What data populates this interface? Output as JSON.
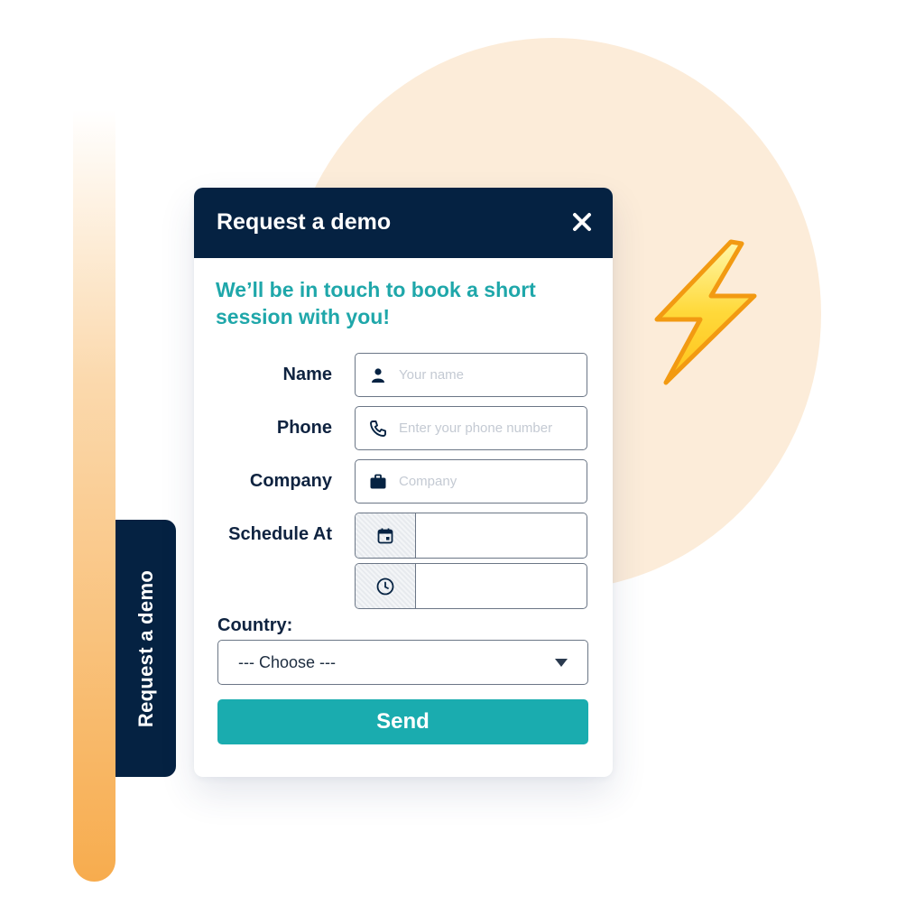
{
  "modal": {
    "title": "Request a demo",
    "close_icon": "close-icon",
    "intro": "We’ll be in touch to book a short session with you!"
  },
  "side_tab": {
    "label": "Request a demo"
  },
  "decoration": {
    "bolt_icon": "lightning-icon"
  },
  "form": {
    "name": {
      "label": "Name",
      "placeholder": "Your name",
      "value": "",
      "icon": "person-icon"
    },
    "phone": {
      "label": "Phone",
      "placeholder": "Enter your phone number",
      "value": "",
      "icon": "phone-icon"
    },
    "company": {
      "label": "Company",
      "placeholder": "Company",
      "value": "",
      "icon": "briefcase-icon"
    },
    "schedule": {
      "label": "Schedule At",
      "date_value": "",
      "date_icon": "calendar-icon",
      "time_value": "",
      "time_icon": "clock-icon"
    },
    "country": {
      "label": "Country:",
      "selected": "--- Choose ---",
      "icon": "caret-down-icon"
    },
    "submit_label": "Send"
  },
  "colors": {
    "navy": "#052242",
    "teal": "#1aacaf",
    "intro_text": "#1fa7aa",
    "peach_circle": "#fcecd9",
    "orange_bar": "#f7ac4e"
  }
}
